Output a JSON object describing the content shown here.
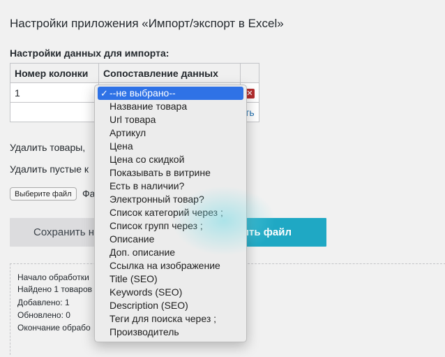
{
  "page": {
    "title": "Настройки приложения «Импорт/экспорт в Excel»",
    "section_title": "Настройки данных для импорта:"
  },
  "table": {
    "headers": [
      "Номер колонки",
      "Сопоставление данных"
    ],
    "row1_col": "1",
    "add_link_partial": "ть"
  },
  "options": {
    "delete_products_partial": "Удалить товары,",
    "delete_empty_partial": "Удалить пустые к"
  },
  "file": {
    "button_label": "Выберите файл",
    "status_partial": "Фа"
  },
  "buttons": {
    "save_partial": "Сохранить н",
    "upload_partial": "ить файл"
  },
  "log": {
    "lines": [
      "Начало обработки",
      "Найдено 1 товаров",
      "Добавлено: 1",
      "Обновлено: 0",
      "Окончание обрабо"
    ]
  },
  "dropdown": {
    "selected": "--не выбрано--",
    "items": [
      "--не выбрано--",
      "Название товара",
      "Url товара",
      "Артикул",
      "Цена",
      "Цена со скидкой",
      "Показывать в витрине",
      "Есть в наличии?",
      "Электронный товар?",
      "Список категорий через ;",
      "Список групп через ;",
      "Описание",
      "Доп. описание",
      "Ссылка на изображение",
      "Title (SEO)",
      "Keywords (SEO)",
      "Description (SEO)",
      "Теги для поиска через ;",
      "Производитель"
    ]
  },
  "colors": {
    "accent_button": "#1fa8c4",
    "selected_option": "#2f72e6",
    "remove_icon": "#b32d2e",
    "link": "#2271b1"
  },
  "icons": {
    "remove": "close-icon",
    "checkmark": "check-icon"
  }
}
